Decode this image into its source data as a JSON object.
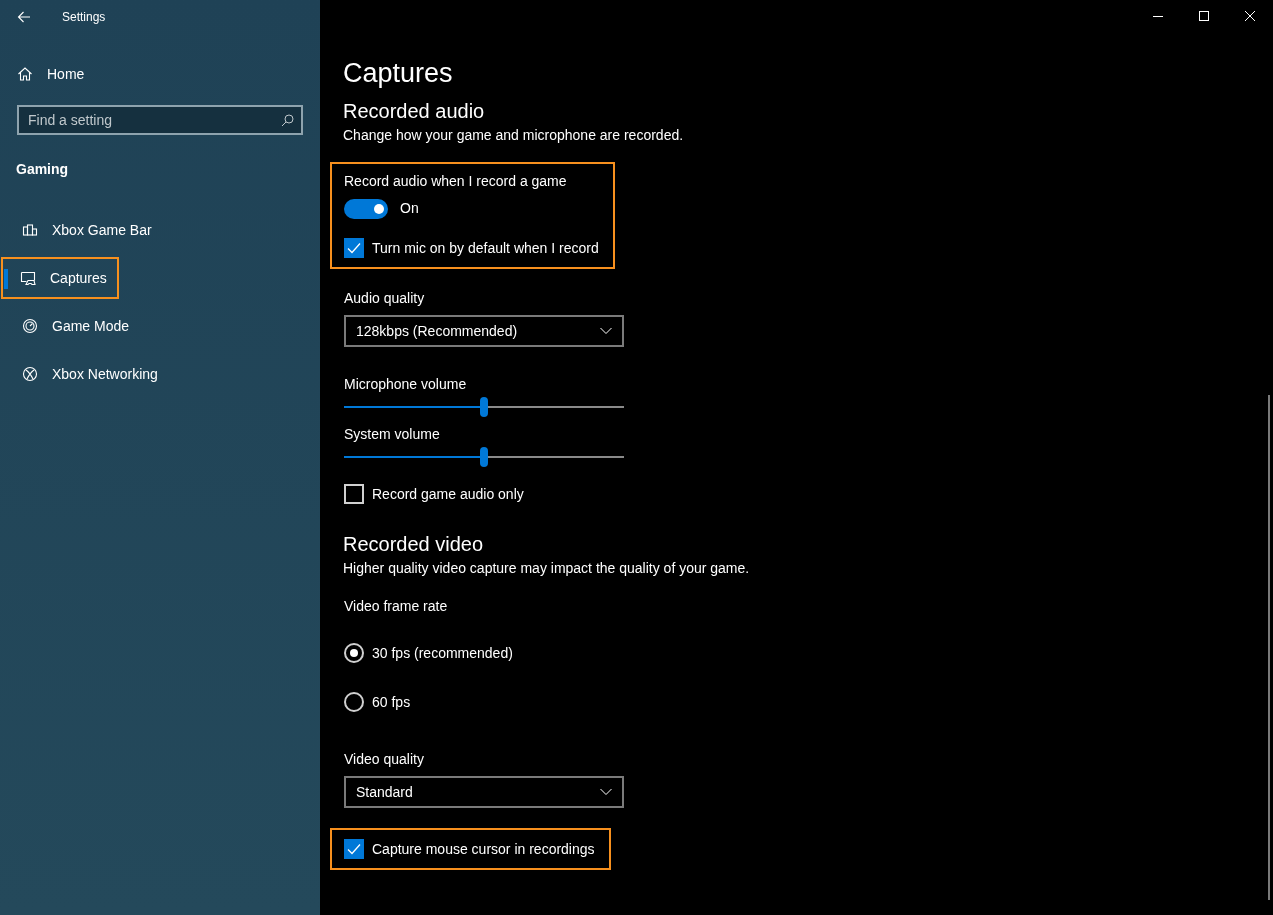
{
  "window": {
    "title": "Settings"
  },
  "sidebar": {
    "home": "Home",
    "search": {
      "placeholder": "Find a setting"
    },
    "section": "Gaming",
    "items": [
      {
        "label": "Xbox Game Bar",
        "selected": false,
        "highlighted": false
      },
      {
        "label": "Captures",
        "selected": true,
        "highlighted": true
      },
      {
        "label": "Game Mode",
        "selected": false,
        "highlighted": false
      },
      {
        "label": "Xbox Networking",
        "selected": false,
        "highlighted": false
      }
    ]
  },
  "page": {
    "title": "Captures",
    "sections": [
      {
        "heading": "Recorded audio",
        "description": "Change how your game and microphone are recorded.",
        "blocks": [
          {
            "kind": "highlight",
            "controls": [
              {
                "kind": "toggle",
                "label": "Record audio when I record a game",
                "on": true,
                "state_text": "On"
              },
              {
                "kind": "checkbox",
                "label": "Turn mic on by default when I record",
                "checked": true
              }
            ]
          },
          {
            "kind": "plain",
            "controls": [
              {
                "kind": "dropdown",
                "label": "Audio quality",
                "value": "128kbps (Recommended)"
              },
              {
                "kind": "slider",
                "label": "Microphone volume",
                "level": 0.5
              },
              {
                "kind": "slider",
                "label": "System volume",
                "level": 0.5
              },
              {
                "kind": "checkbox",
                "label": "Record game audio only",
                "checked": false
              }
            ]
          }
        ]
      },
      {
        "heading": "Recorded video",
        "description": "Higher quality video capture may impact the quality of your game.",
        "blocks": [
          {
            "kind": "plain",
            "controls": [
              {
                "kind": "radiogroup",
                "label": "Video frame rate",
                "options": [
                  {
                    "label": "30 fps (recommended)",
                    "selected": true
                  },
                  {
                    "label": "60 fps",
                    "selected": false
                  }
                ]
              },
              {
                "kind": "dropdown",
                "label": "Video quality",
                "value": "Standard"
              }
            ]
          },
          {
            "kind": "highlight",
            "controls": [
              {
                "kind": "checkbox",
                "label": "Capture mouse cursor in recordings",
                "checked": true
              }
            ]
          }
        ]
      }
    ]
  }
}
